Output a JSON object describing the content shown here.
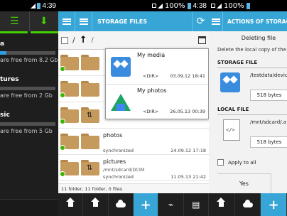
{
  "panel1": {
    "status": {
      "time": "4:39"
    },
    "storages": [
      {
        "name": "a",
        "free_text": "are free from 8.2 Gb",
        "usage": 0.12
      },
      {
        "name": "tures",
        "free_text": "are free from 2 Gb",
        "usage": 0.0
      },
      {
        "name": "sic",
        "free_text": "are free from 5 Gb",
        "usage": 0.0
      }
    ]
  },
  "panel2": {
    "status": {
      "battery": "100%",
      "time": "4:38"
    },
    "title": "STORAGE FILES",
    "path_segment": "/",
    "popup": [
      {
        "name": "My media",
        "dir": "<DIR>",
        "date": "03.09.12 18:41",
        "icon": "dropbox-icon"
      },
      {
        "name": "My photos",
        "dir": "<DIR>",
        "date": "26.05.13 00:39",
        "icon": "google-drive-icon"
      }
    ],
    "files": [
      {
        "name": "",
        "sub": "",
        "status": "",
        "date": ""
      },
      {
        "name": "",
        "sub": "",
        "status": "",
        "date": ""
      },
      {
        "name": "",
        "sub": "",
        "status": "",
        "date": ""
      },
      {
        "name": "photos",
        "sub": "",
        "status": "synchronized",
        "date": "24.09.12 17:18"
      },
      {
        "name": "pictures",
        "sub": "/mnt/sdcard/DCIM",
        "status": "synchronized",
        "date": "11.05.13 21:42"
      },
      {
        "name": "podcasts",
        "sub": "",
        "status": "",
        "date": ""
      }
    ],
    "count_text": "11 folder, 11 folder, 0 files"
  },
  "panel3": {
    "status": {
      "battery": "100%"
    },
    "title": "ACTIONS OF STORAGE",
    "dialog": {
      "title": "Deleting file",
      "description": "Delete the local copy of the",
      "storage_section": "STORAGE FILE",
      "storage_path": "/testdata/devic",
      "storage_size": "518 bytes",
      "local_section": "LOCAL FILE",
      "local_path": "/mnt/sdcard/.a",
      "local_size": "518 bytes",
      "apply_label": "Apply to all",
      "yes_label": "Yes"
    }
  },
  "colors": {
    "accent_blue": "#37a6d6",
    "accent_green": "#45d000"
  }
}
